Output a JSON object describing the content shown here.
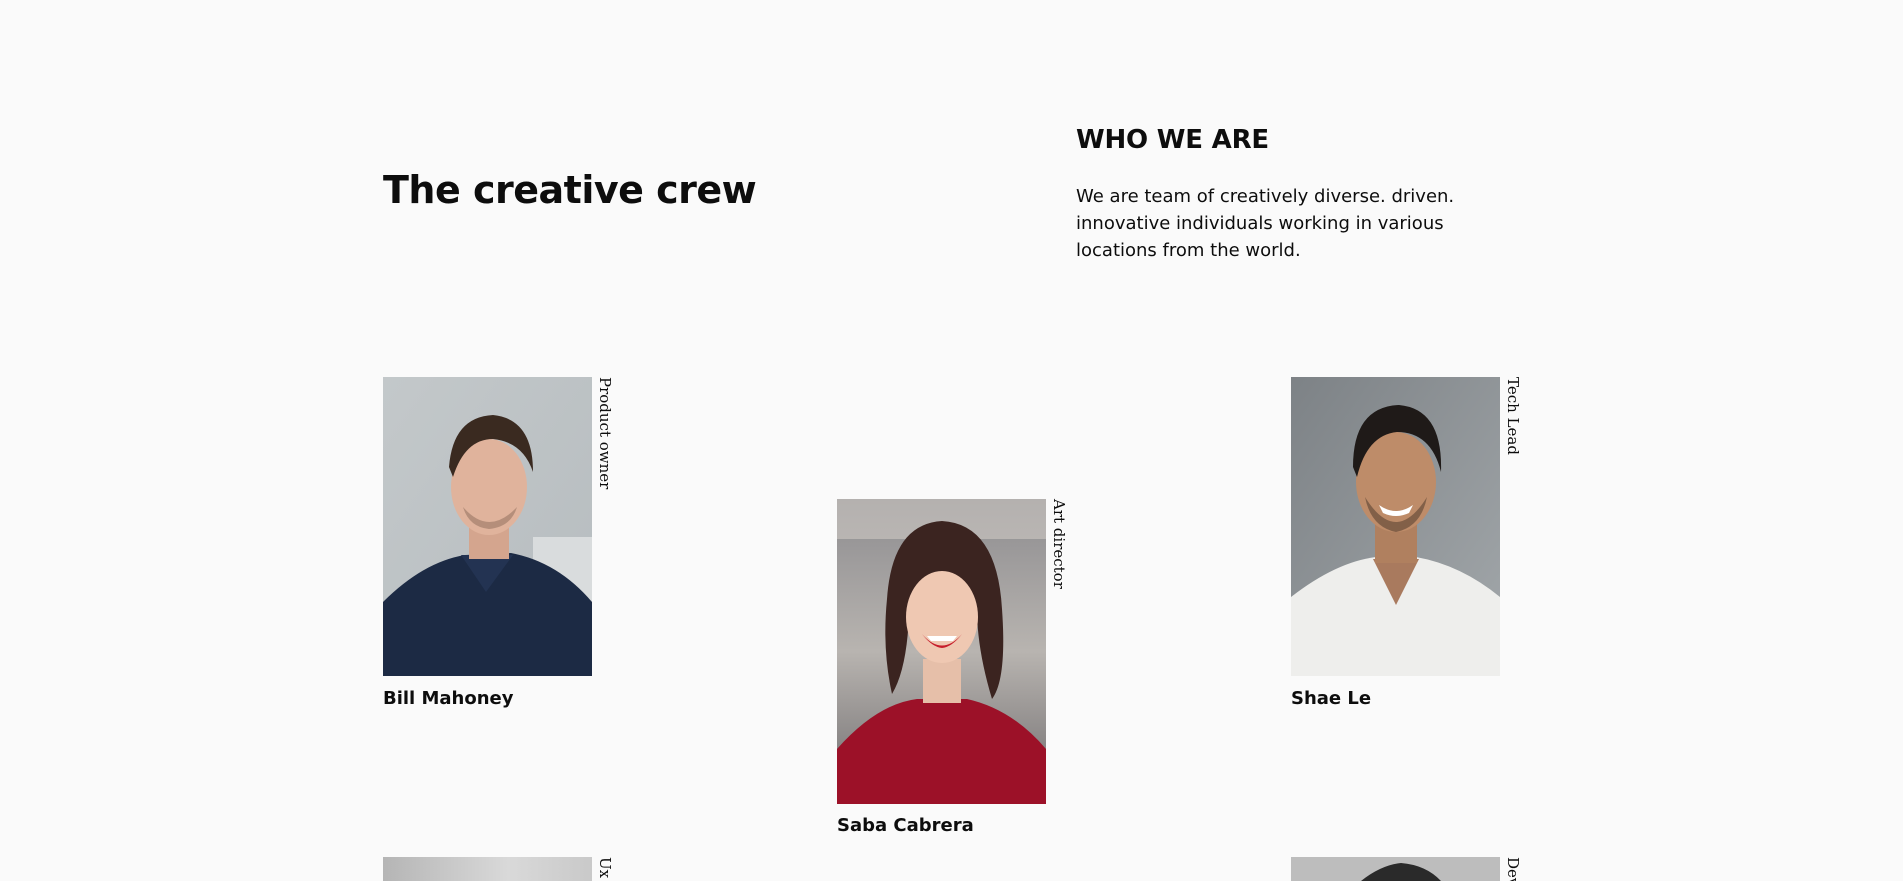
{
  "section": {
    "title": "The creative crew",
    "who_heading": "WHO WE ARE",
    "who_text": "We are team of creatively diverse. driven. innovative individuals working in various locations from the world."
  },
  "team": [
    {
      "name": "Bill Mahoney",
      "role": "Product owner"
    },
    {
      "name": "Saba Cabrera",
      "role": "Art director"
    },
    {
      "name": "Shae Le",
      "role": "Tech Lead"
    },
    {
      "name": "",
      "role": "Ux"
    },
    {
      "name": "",
      "role": "Dev"
    }
  ]
}
